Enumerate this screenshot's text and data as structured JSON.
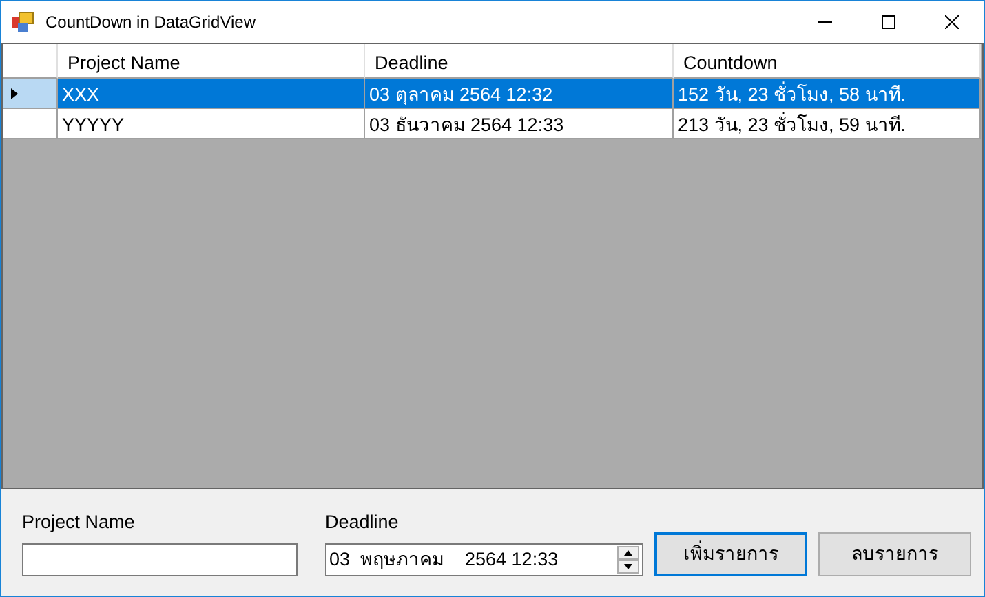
{
  "window": {
    "title": "CountDown in DataGridView"
  },
  "grid": {
    "columns": [
      "Project Name",
      "Deadline",
      "Countdown"
    ],
    "rows": [
      {
        "selected": true,
        "cells": [
          "XXX",
          "03 ตุลาคม 2564 12:32",
          "152 วัน, 23 ชั่วโมง, 58 นาที."
        ]
      },
      {
        "selected": false,
        "cells": [
          "YYYYY",
          "03 ธันวาคม 2564 12:33",
          "213 วัน, 23 ชั่วโมง, 59 นาที."
        ]
      }
    ]
  },
  "form": {
    "project_name": {
      "label": "Project Name"
    },
    "deadline": {
      "label": "Deadline",
      "value": "03  พฤษภาคม    2564 12:33"
    },
    "buttons": [
      {
        "label": "เพิ่มรายการ",
        "focused": true
      },
      {
        "label": "ลบรายการ",
        "focused": false
      }
    ]
  }
}
